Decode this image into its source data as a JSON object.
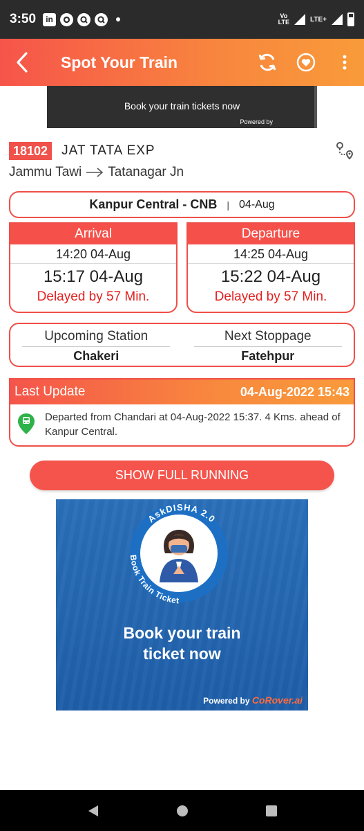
{
  "status_bar": {
    "time": "3:50",
    "left_icons": [
      "linkedin-icon",
      "circle-app-icon",
      "q-app-icon",
      "q-app-icon"
    ],
    "network_vo": "Vo",
    "network_lte": "LTE",
    "network_lte2": "LTE+"
  },
  "header": {
    "title": "Spot Your Train",
    "gradient_start": "#f6544a",
    "gradient_end": "#f99b3a"
  },
  "top_ad": {
    "text": "Book your train tickets now",
    "powered": "Powered by"
  },
  "train": {
    "number": "18102",
    "name": "JAT  TATA  EXP",
    "from": "Jammu Tawi",
    "to": "Tatanagar Jn"
  },
  "station": {
    "name": "Kanpur Central - CNB",
    "separator": "|",
    "date": "04-Aug"
  },
  "arrival": {
    "label": "Arrival",
    "scheduled": "14:20 04-Aug",
    "actual": "15:17 04-Aug",
    "delay": "Delayed by 57 Min."
  },
  "departure": {
    "label": "Departure",
    "scheduled": "14:25 04-Aug",
    "actual": "15:22 04-Aug",
    "delay": "Delayed by 57 Min."
  },
  "upcoming": {
    "upcoming_label": "Upcoming Station",
    "upcoming_value": "Chakeri",
    "next_label": "Next Stoppage",
    "next_value": "Fatehpur"
  },
  "last_update": {
    "title": "Last Update",
    "timestamp": "04-Aug-2022 15:43",
    "message": "Departed from Chandari at 04-Aug-2022 15:37. 4 Kms. ahead of Kanpur Central."
  },
  "show_full_running": "SHOW FULL RUNNING",
  "big_ad": {
    "ring_top": "AskDISHA 2.0",
    "ring_side": "Book Train Ticket",
    "headline_1": "Book your train",
    "headline_2": "ticket now",
    "powered": "Powered by",
    "brand": "CoRover.ai"
  },
  "colors": {
    "accent": "#ef4f49",
    "delay": "#e21f1f",
    "ad_blue": "#2a6fb8"
  }
}
